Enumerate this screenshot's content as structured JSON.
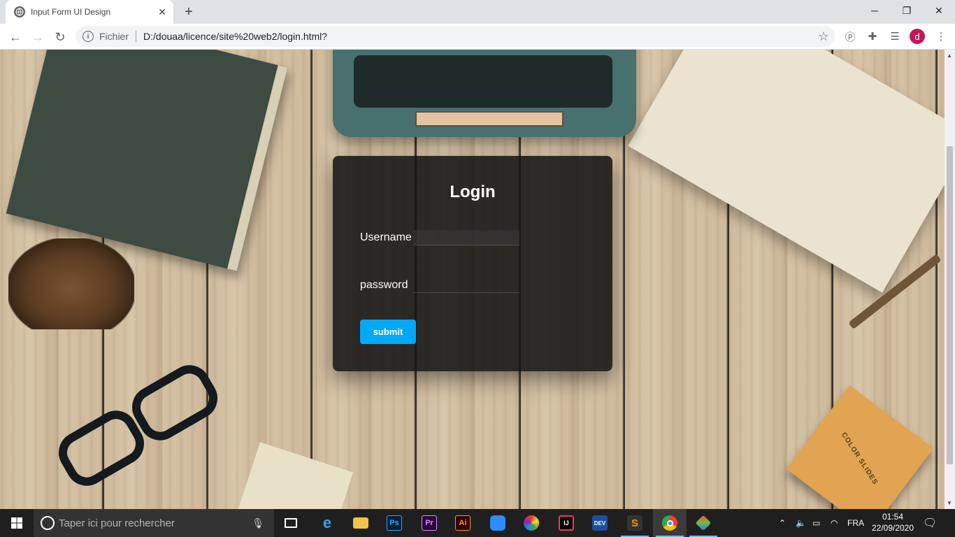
{
  "browser": {
    "tab_title": "Input Form UI Design",
    "new_tab_symbol": "+",
    "url_scheme_label": "Fichier",
    "url": "D:/douaa/licence/site%20web2/login.html?",
    "profile_initial": "d"
  },
  "login": {
    "title": "Login",
    "username_label": "Username",
    "username_placeholder": "",
    "password_label": "password",
    "submit_label": "submit",
    "accent_color": "#03a9f4"
  },
  "decor": {
    "colorbox_text": "COLOR SLIDES"
  },
  "taskbar": {
    "search_placeholder": "Taper ici pour rechercher",
    "apps": [
      {
        "name": "task-view",
        "label": ""
      },
      {
        "name": "edge",
        "label": "e"
      },
      {
        "name": "file-explorer",
        "label": ""
      },
      {
        "name": "photoshop",
        "label": "Ps"
      },
      {
        "name": "premiere",
        "label": "Pr"
      },
      {
        "name": "illustrator",
        "label": "Ai"
      },
      {
        "name": "zoom",
        "label": ""
      },
      {
        "name": "color-app",
        "label": ""
      },
      {
        "name": "intellij",
        "label": "IJ"
      },
      {
        "name": "dev-cpp",
        "label": "DEV"
      },
      {
        "name": "sublime",
        "label": "S"
      },
      {
        "name": "chrome",
        "label": ""
      },
      {
        "name": "git",
        "label": ""
      }
    ],
    "language": "FRA",
    "time": "01:54",
    "date": "22/09/2020"
  }
}
